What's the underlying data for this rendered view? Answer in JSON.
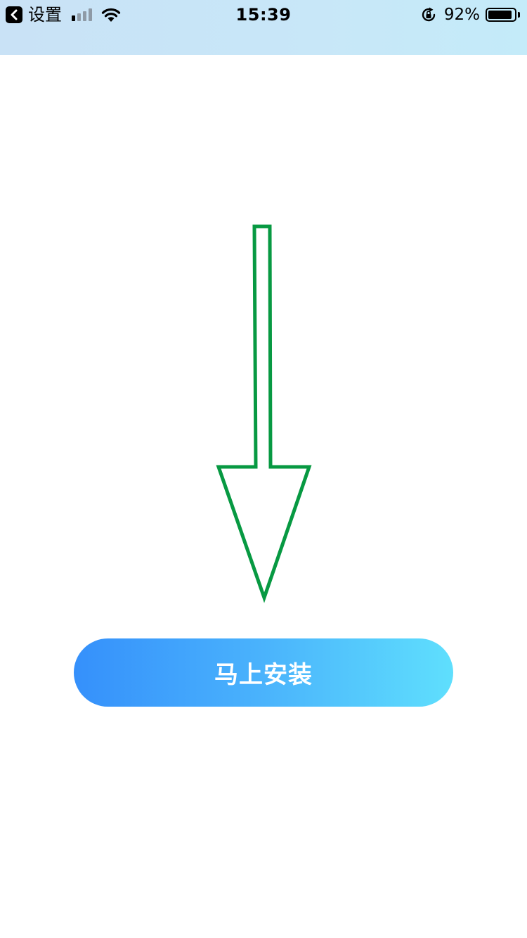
{
  "status_bar": {
    "back_label": "设置",
    "time": "15:39",
    "battery_percent": "92%",
    "battery_level": 0.92,
    "signal_bars_on": 1,
    "signal_bars_total": 4,
    "icons": [
      "back-arrow-icon",
      "signal-icon",
      "wifi-icon",
      "orientation-lock-icon",
      "battery-icon"
    ]
  },
  "main": {
    "arrow_color": "#079942",
    "install_button_label": "马上安装",
    "install_button_gradient": [
      "#3590fb",
      "#5fdffd"
    ]
  }
}
